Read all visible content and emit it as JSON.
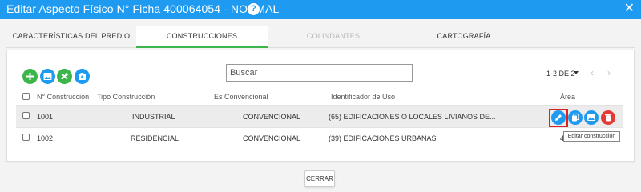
{
  "dialog": {
    "title": "Editar Aspecto Físico N° Ficha 400064054 - NORMAL",
    "help_symbol": "?",
    "close_symbol": "✕"
  },
  "tabs": [
    {
      "label": "CARACTERÍSTICAS DEL PREDIO",
      "state": "normal"
    },
    {
      "label": "CONSTRUCCIONES",
      "state": "active"
    },
    {
      "label": "COLINDANTES",
      "state": "disabled"
    },
    {
      "label": "CARTOGRAFÍA",
      "state": "normal"
    }
  ],
  "toolbar": {
    "buttons": [
      {
        "icon": "plus-icon",
        "color": "#3cb54a"
      },
      {
        "icon": "image-icon",
        "color": "#1e9af0"
      },
      {
        "icon": "tools-icon",
        "color": "#3cb54a"
      },
      {
        "icon": "package-icon",
        "color": "#1e9af0"
      }
    ],
    "search_placeholder": "Buscar"
  },
  "pager": {
    "range": "1-2 DE 2",
    "prev_symbol": "‹",
    "next_symbol": "›"
  },
  "table": {
    "columns": [
      "N° Construcción",
      "Tipo Construcción",
      "Es Convencional",
      "Identificador de Uso",
      "Área"
    ],
    "rows": [
      {
        "numero": "1001",
        "tipo": "INDUSTRIAL",
        "convencional": "CONVENCIONAL",
        "uso": "(65) EDIFICACIONES O LOCALES LIVIANOS DE...",
        "area": ""
      },
      {
        "numero": "1002",
        "tipo": "RESIDENCIAL",
        "convencional": "CONVENCIONAL",
        "uso": "(39) EDIFICACIONES URBANAS",
        "area": "4"
      }
    ],
    "row_actions": [
      {
        "icon": "pencil-icon",
        "color": "#1e9af0"
      },
      {
        "icon": "copy-icon",
        "color": "#1e9af0"
      },
      {
        "icon": "image-icon",
        "color": "#1e9af0"
      },
      {
        "icon": "trash-icon",
        "color": "#e53935"
      }
    ]
  },
  "tooltip": "Editar construcción",
  "footer": {
    "close_label": "CERRAR"
  },
  "colors": {
    "primary": "#1e9af0",
    "success": "#3cb54a",
    "danger": "#e53935",
    "highlight": "#dd2222"
  }
}
